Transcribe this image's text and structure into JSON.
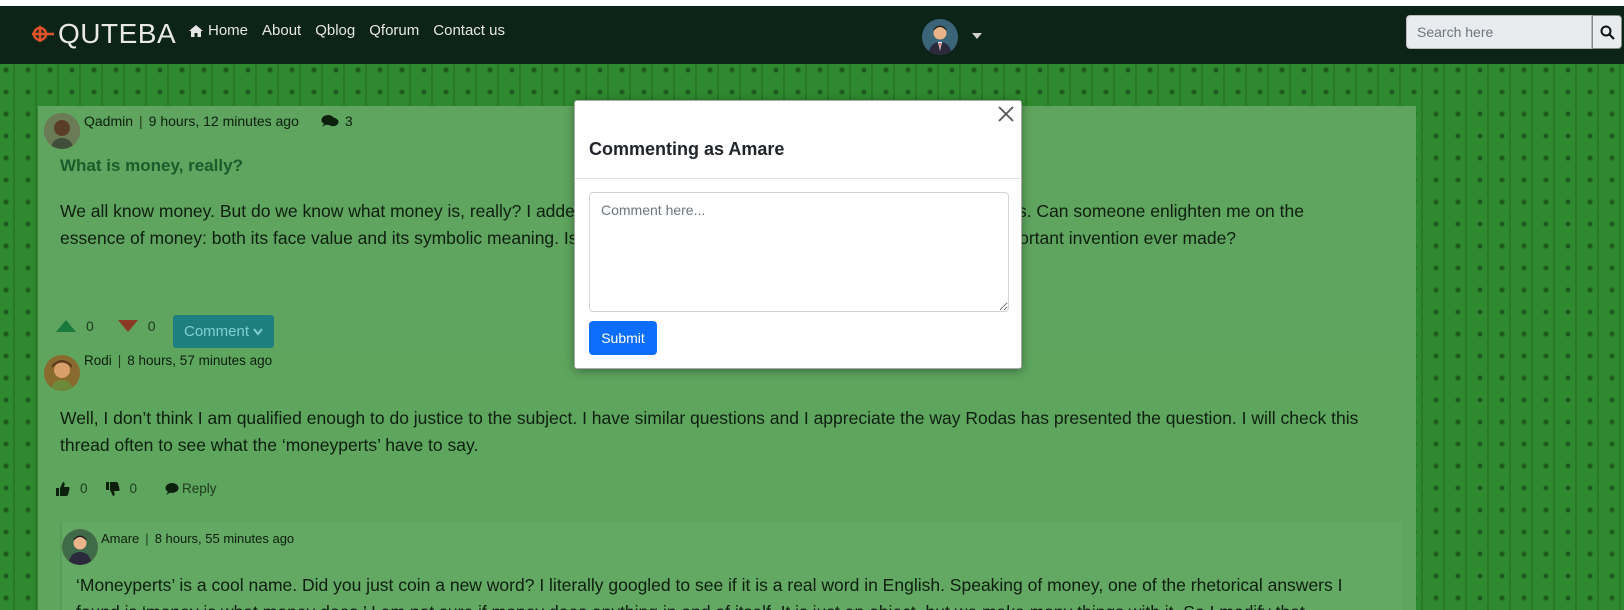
{
  "brand": {
    "name": "QUTEBA",
    "logo_icon": "quteba-logo-icon"
  },
  "nav": {
    "items": [
      {
        "label": "Home",
        "icon": "home-icon"
      },
      {
        "label": "About"
      },
      {
        "label": "Qblog"
      },
      {
        "label": "Qforum"
      },
      {
        "label": "Contact us"
      }
    ]
  },
  "search": {
    "placeholder": "Search here",
    "icon": "search-icon"
  },
  "post": {
    "author": "Qadmin",
    "time": "9 hours, 12 minutes ago",
    "comment_count": "3",
    "title": "What is money, really?",
    "body": "We all know money. But do we know what money is, really? I added the question here because I've been looking for answers. Can someone enlighten me on the essence of money: both its face value and its symbolic meaning. Is money good or bad? Can we say money is the most important invention ever made?",
    "upvotes": "0",
    "downvotes": "0",
    "comment_button": "Comment"
  },
  "reply": {
    "author": "Rodi",
    "time": "8 hours, 57 minutes ago",
    "body": "Well, I don’t think I am qualified enough to do justice to the subject. I have similar questions and I appreciate the way Rodas has presented the question. I will check this thread often to see what the ‘moneyperts’ have to say.",
    "likes": "0",
    "dislikes": "0",
    "reply_label": "Reply"
  },
  "nested_reply": {
    "author": "Amare",
    "time": "8 hours, 55 minutes ago",
    "body": "‘Moneyperts’ is a cool name. Did you just coin a new word? I literally googled to see if it is a real word in English. Speaking of money, one of the rhetorical answers I found is ‘money is what money does.’ I am not sure if money does anything in and of itself. It is just an object, but we make many things with it. So I modify that"
  },
  "modal": {
    "title": "Commenting as Amare",
    "placeholder": "Comment here...",
    "submit_label": "Submit"
  },
  "colors": {
    "navbar": "#0c2417",
    "pattern_bg": "#2f8a2f",
    "primary": "#0d6efd",
    "comment_btn": "#1f7f80"
  }
}
